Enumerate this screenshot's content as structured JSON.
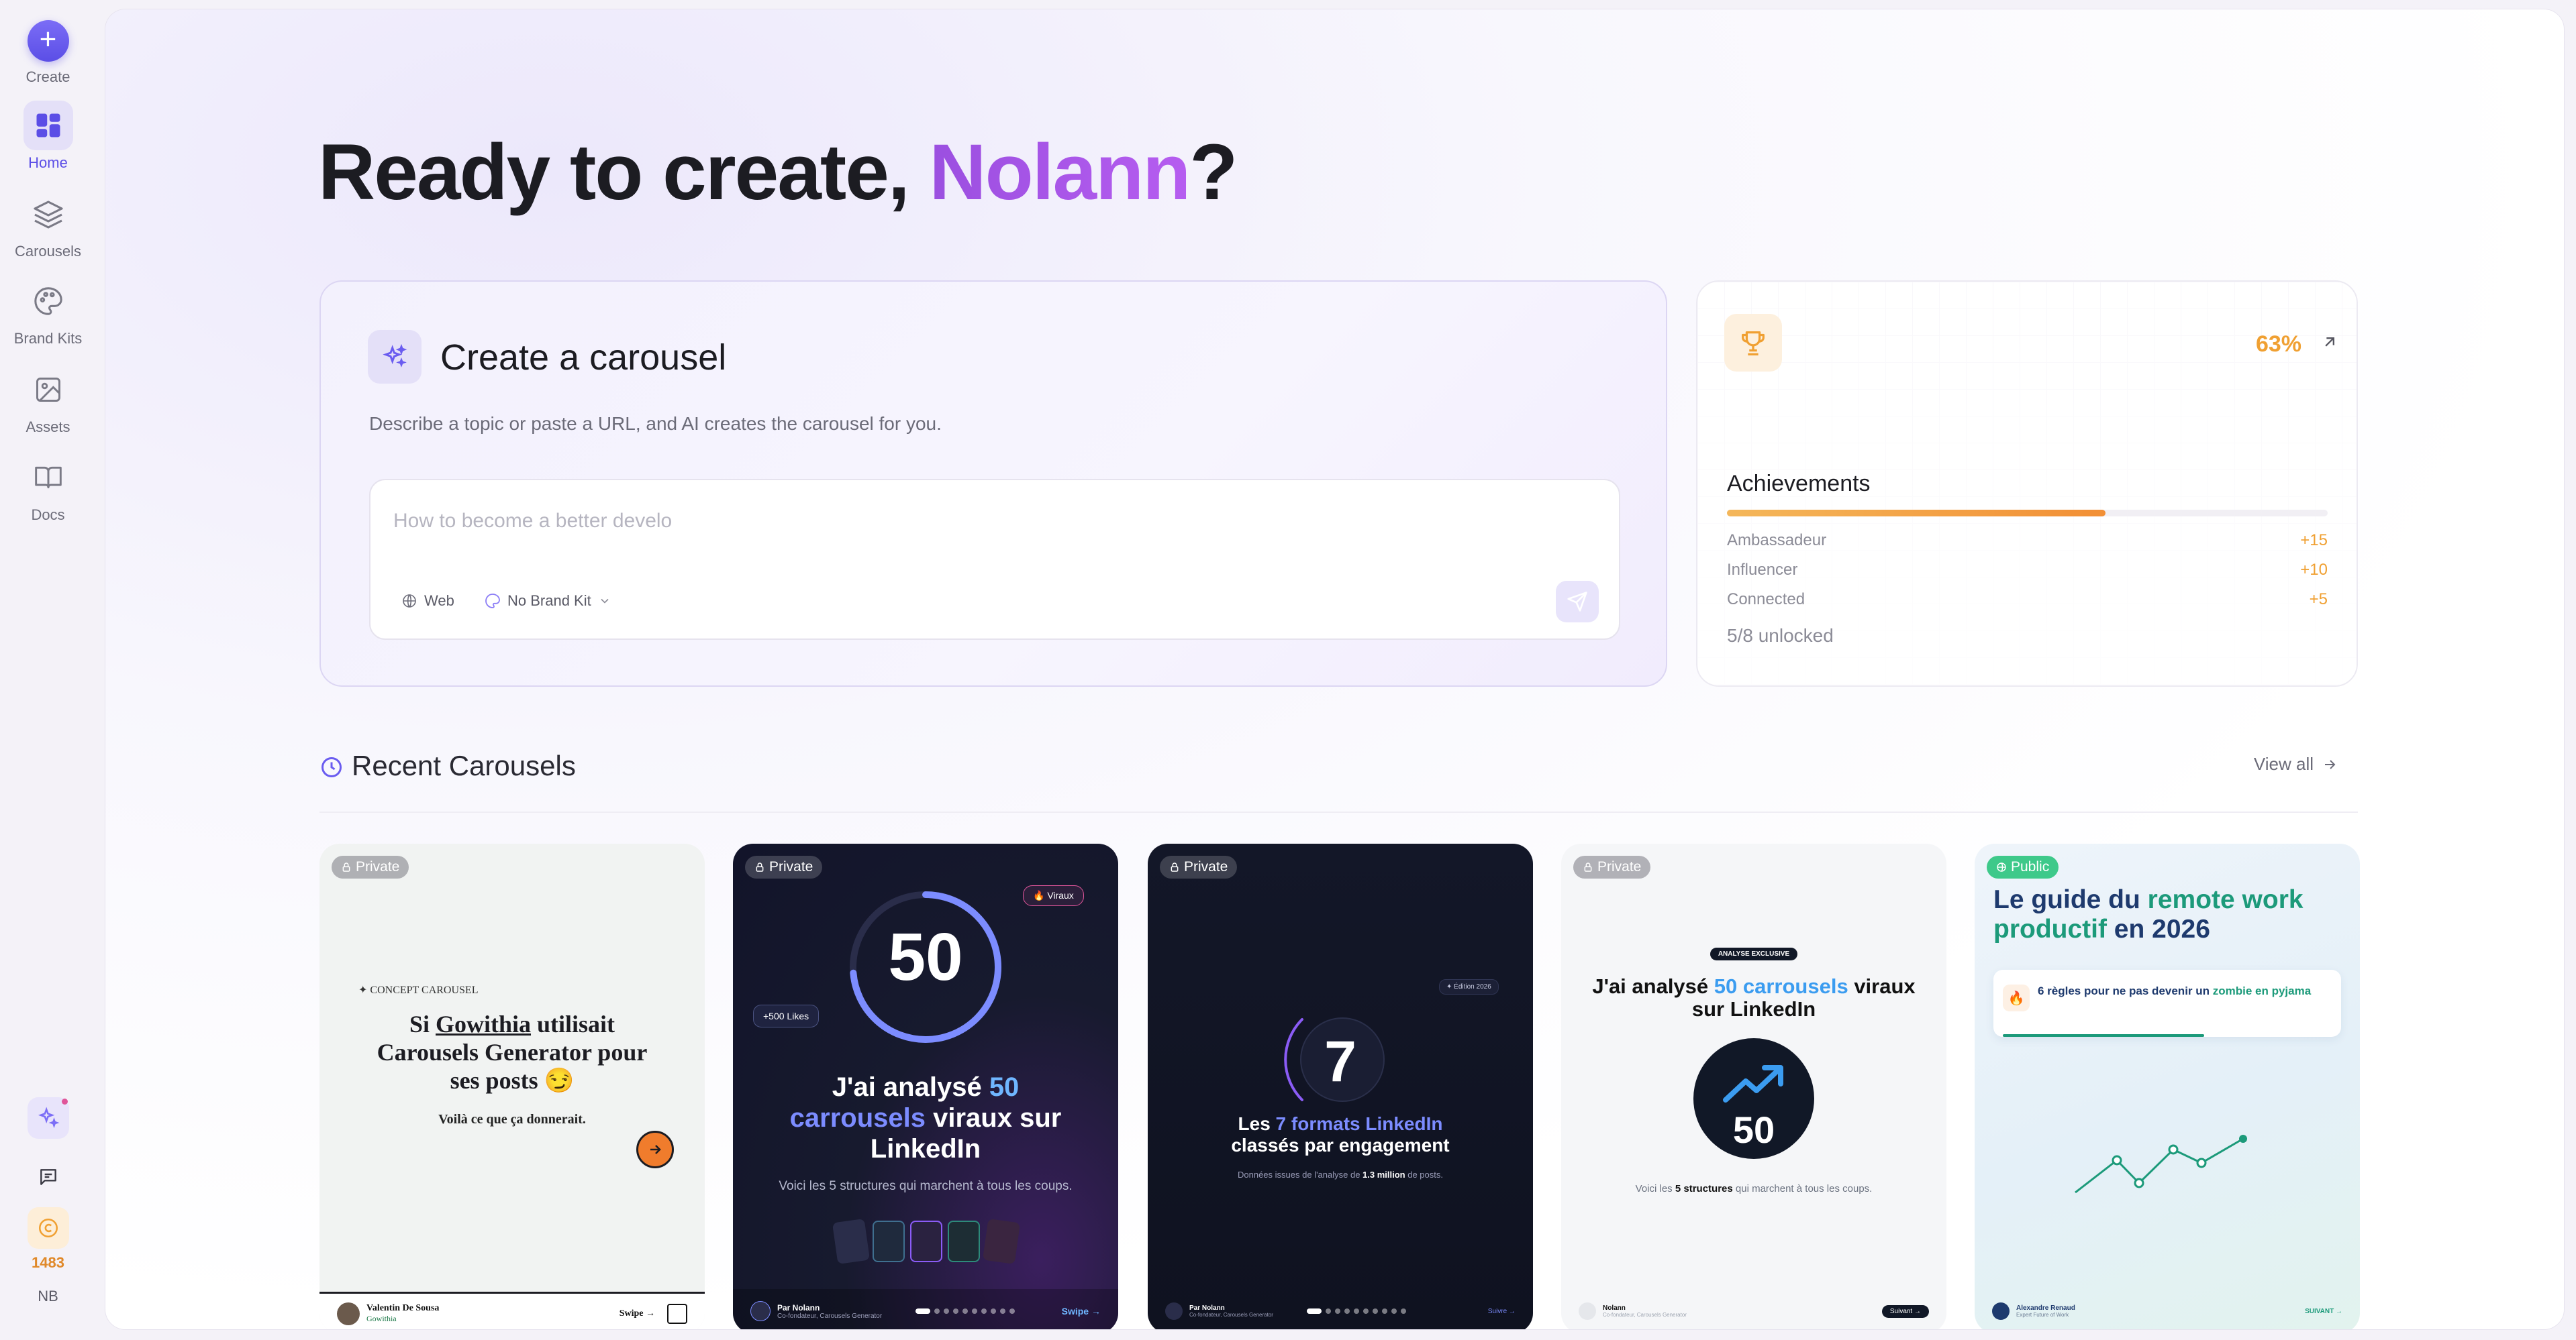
{
  "sidebar": {
    "create_label": "Create",
    "items": [
      {
        "label": "Home",
        "icon": "home-grid-icon",
        "active": true
      },
      {
        "label": "Carousels",
        "icon": "layers-icon",
        "active": false
      },
      {
        "label": "Brand Kits",
        "icon": "palette-icon",
        "active": false
      },
      {
        "label": "Assets",
        "icon": "image-icon",
        "active": false
      },
      {
        "label": "Docs",
        "icon": "book-icon",
        "active": false
      }
    ],
    "credits": "1483",
    "avatar_initials": "NB"
  },
  "greeting": {
    "prefix": "Ready to create, ",
    "name": "Nolann",
    "suffix": "?"
  },
  "create_card": {
    "title": "Create a carousel",
    "description": "Describe a topic or paste a URL, and AI creates the carousel for you.",
    "input_value": "",
    "input_placeholder": "How to become a better develo",
    "web_label": "Web",
    "brand_kit_label": "No Brand Kit"
  },
  "achievements": {
    "percent": "63%",
    "progress": 0.63,
    "title": "Achievements",
    "rows": [
      {
        "label": "Ambassadeur",
        "points": "+15"
      },
      {
        "label": "Influencer",
        "points": "+10"
      },
      {
        "label": "Connected",
        "points": "+5"
      }
    ],
    "unlocked": "5/8 unlocked"
  },
  "recent": {
    "title": "Recent Carousels",
    "view_all": "View all"
  },
  "cards": [
    {
      "visibility": "Private",
      "kicker": "✦ CONCEPT CAROUSEL",
      "line1_a": "Si ",
      "line1_b": "Gowithia",
      "line1_c": " utilisait",
      "line2": "Carousels Generator pour",
      "line3": "ses posts 😏",
      "sub": "Voilà ce que ça donnerait.",
      "author": "Valentin De Sousa",
      "author_sub": "Gowithia",
      "swipe": "Swipe →"
    },
    {
      "visibility": "Private",
      "number": "50",
      "tag_viral": "🔥 Viraux",
      "tag_likes": "+500 Likes",
      "headline_a": "J'ai analysé ",
      "headline_b": "50",
      "headline_c": "carrousels",
      "headline_d": " viraux sur",
      "headline_e": "LinkedIn",
      "sub": "Voici les 5 structures qui marchent à tous les coups.",
      "author": "Par Nolann",
      "author_sub": "Co-fondateur, Carousels Generator",
      "swipe": "Swipe →"
    },
    {
      "visibility": "Private",
      "number": "7",
      "tag": "✦ Édition 2026",
      "headline_a": "Les ",
      "headline_b": "7 formats LinkedIn",
      "headline_c": "classés par engagement",
      "sub_a": "Données issues de l'analyse de ",
      "sub_b": "1.3 million",
      "sub_c": " de posts.",
      "author": "Par Nolann",
      "author_sub": "Co-fondateur, Carousels Generator",
      "swipe": "Suivre →"
    },
    {
      "visibility": "Private",
      "tag": "ANALYSE EXCLUSIVE",
      "headline_a": "J'ai analysé ",
      "headline_b": "50 carrousels",
      "headline_c": " viraux",
      "headline_d": "sur LinkedIn",
      "number": "50",
      "sub_a": "Voici les ",
      "sub_b": "5 structures",
      "sub_c": " qui marchent à tous les coups.",
      "author": "Nolann",
      "author_sub": "Co-fondateur, Carousels Generator",
      "swipe": "Suivant →"
    },
    {
      "visibility": "Public",
      "headline_a": "Le guide du ",
      "headline_b": "remote work",
      "headline_c": "productif",
      "headline_d": " en 2026",
      "note_a": "6 règles pour ne pas devenir un ",
      "note_b": "zombie en pyjama",
      "author": "Alexandre Renaud",
      "author_sub": "Expert Future of Work",
      "swipe": "SUIVANT →"
    }
  ],
  "colors": {
    "accent": "#5b4ee6",
    "name_gradient": "#a855f7",
    "achievement_orange": "#f0a032"
  }
}
